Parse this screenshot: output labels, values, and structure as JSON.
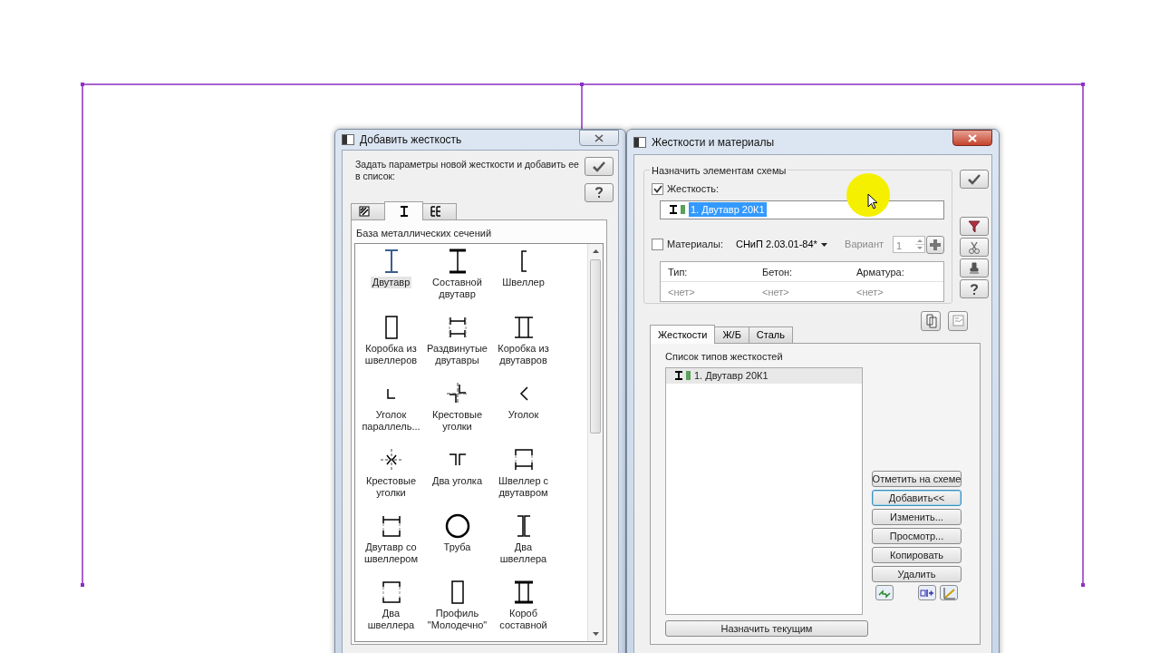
{
  "add_window": {
    "title": "Добавить жесткость",
    "description": "Задать параметры новой жесткости и добавить ее в список:",
    "tabs": [
      {
        "kind": "hatch",
        "selected": false
      },
      {
        "kind": "ibeam",
        "selected": true
      },
      {
        "kind": "double",
        "selected": false
      }
    ],
    "group_label": "База металлических сечений",
    "sections": [
      {
        "kind": "ibeam",
        "label": "Двутавр",
        "selected": true
      },
      {
        "kind": "built-ibeam",
        "label": "Составной двутавр",
        "selected": false
      },
      {
        "kind": "channel",
        "label": "Швеллер",
        "selected": false
      },
      {
        "kind": "box-channels",
        "label": "Коробка из швеллеров",
        "selected": false
      },
      {
        "kind": "spread-ibeams",
        "label": "Раздвинутые двутавры",
        "selected": false
      },
      {
        "kind": "box-ibeams",
        "label": "Коробка из двутавров",
        "selected": false
      },
      {
        "kind": "angle-l",
        "label": "Уголок параллель...",
        "selected": false
      },
      {
        "kind": "cross-angles",
        "label": "Крестовые уголки",
        "selected": false
      },
      {
        "kind": "angle-v",
        "label": "Уголок",
        "selected": false
      },
      {
        "kind": "cross-angles-v",
        "label": "Крестовые уголки",
        "selected": false
      },
      {
        "kind": "two-angles",
        "label": "Два уголка",
        "selected": false
      },
      {
        "kind": "channel-ibeam",
        "label": "Швеллер с двутавром",
        "selected": false
      },
      {
        "kind": "ibeam-channel",
        "label": "Двутавр со швеллером",
        "selected": false
      },
      {
        "kind": "pipe",
        "label": "Труба",
        "selected": false
      },
      {
        "kind": "two-channels",
        "label": "Два швеллера",
        "selected": false
      },
      {
        "kind": "two-channels-box",
        "label": "Два швеллера",
        "selected": false
      },
      {
        "kind": "profile",
        "label": "Профиль \"Молодечно\"",
        "selected": false
      },
      {
        "kind": "built-box",
        "label": "Короб составной",
        "selected": false
      }
    ]
  },
  "materials_window": {
    "title": "Жесткости и материалы",
    "group_label": "Назначить элементам схемы",
    "stiffness": {
      "label": "Жесткость:",
      "checked": true
    },
    "stiffness_field": {
      "value": "1. Двутавр 20К1",
      "color": "#5aa05a",
      "selected": true
    },
    "materials": {
      "label": "Материалы:",
      "checked": false
    },
    "norm": "СНиП 2.03.01-84*",
    "variant": {
      "label": "Вариант",
      "value": "1",
      "disabled": true
    },
    "table": {
      "columns": [
        "Тип:",
        "Бетон:",
        "Арматура:"
      ],
      "rows": [
        [
          "<нет>",
          "<нет>",
          "<нет>"
        ]
      ]
    },
    "tabs": [
      {
        "label": "Жесткости",
        "selected": true
      },
      {
        "label": "Ж/Б",
        "selected": false
      },
      {
        "label": "Сталь",
        "selected": false
      }
    ],
    "list_label": "Список типов жесткостей",
    "list": [
      {
        "label": "1. Двутавр 20К1",
        "color": "#5aa05a",
        "selected": true
      }
    ],
    "buttons": [
      {
        "label": "Отметить на схеме",
        "default": false
      },
      {
        "label": "Добавить<<",
        "default": true
      },
      {
        "label": "Изменить...",
        "default": false
      },
      {
        "label": "Просмотр...",
        "default": false
      },
      {
        "label": "Копировать",
        "default": false
      },
      {
        "label": "Удалить",
        "default": false
      }
    ],
    "assign_button": "Назначить текущим"
  }
}
